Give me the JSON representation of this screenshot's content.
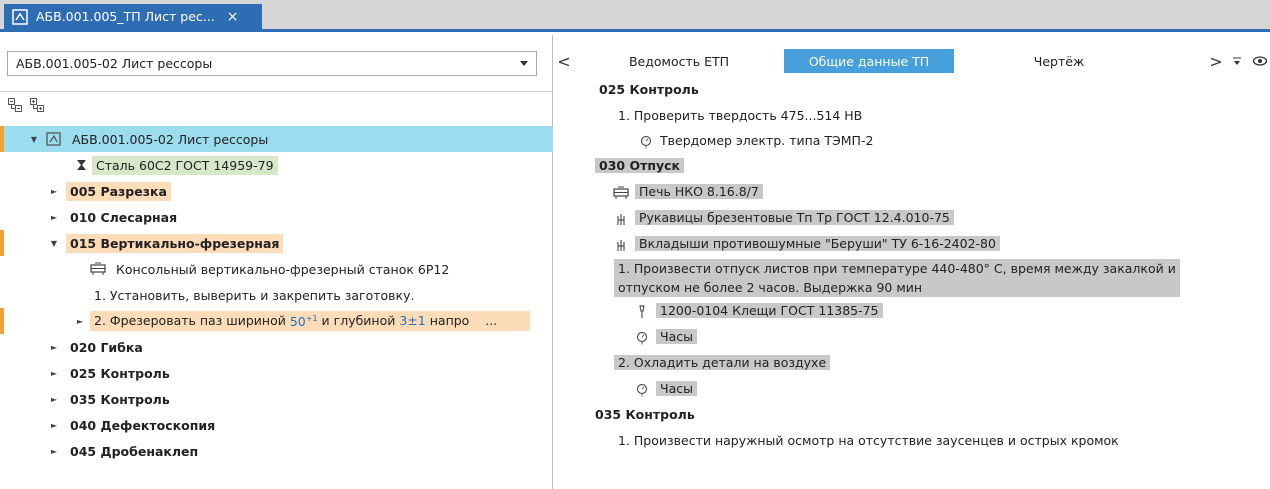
{
  "tab": {
    "title": "АБВ.001.005_ТП Лист рес...",
    "close": "×"
  },
  "left": {
    "combo_value": "АБВ.001.005-02 Лист рессоры",
    "tree": {
      "root": "АБВ.001.005-02 Лист рессоры",
      "material": "Сталь 60С2 ГОСТ 14959-79",
      "op005": "005 Разрезка",
      "op010": "010 Слесарная",
      "op015": "015 Вертикально-фрезерная",
      "machine": "Консольный вертикально-фрезерный станок 6Р12",
      "step1": "1. Установить, выверить и закрепить заготовку.",
      "step2_a": "2. Фрезеровать паз шириной",
      "step2_w": "50",
      "step2_wsup": "+1",
      "step2_b": "и глубиной",
      "step2_d": "3±1",
      "step2_c": "напро",
      "step2_more": "...",
      "op020": "020 Гибка",
      "op025": "025 Контроль",
      "op035": "035 Контроль",
      "op040": "040 Дефектоскопия",
      "op045": "045 Дробенаклеп"
    }
  },
  "right": {
    "nav_prev": "<",
    "nav_next": ">",
    "tabs": [
      "Ведомость ЕТП",
      "Общие данные ТП",
      "Чертёж"
    ],
    "lines": {
      "h025": "025 Контроль",
      "s025_1": "1. Проверить твердость 475...514 НВ",
      "s025_tool": "Твердомер электр. типа ТЭМП-2",
      "h030": "030 Отпуск",
      "furnace": "Печь НКО 8.16.8/7",
      "gloves": "Рукавицы брезентовые Тп Тр ГОСТ 12.4.010-75",
      "earplugs": "Вкладыши противошумные \"Беруши\" ТУ 6-16-2402-80",
      "s030_1a": "1. Произвести отпуск листов при температуре 440-480° С, время между закалкой и",
      "s030_1b": "отпуском не более 2 часов. Выдержка 90 мин",
      "tongs": "1200-0104 Клещи ГОСТ 11385-75",
      "clock1": "Часы",
      "s030_2": "2. Охладить детали на воздухе",
      "clock2": "Часы",
      "h035": "035 Контроль",
      "s035_1": "1. Произвести наружный осмотр на отсутствие заусенцев и острых кромок"
    }
  },
  "colors": {
    "accent": "#2e6db4",
    "selected_row": "#9bdcef",
    "orange_highlight": "#fcdcb9",
    "green_highlight": "#d6e8c9",
    "gray_highlight": "#c8c8c8",
    "active_tab": "#47a0dc"
  }
}
